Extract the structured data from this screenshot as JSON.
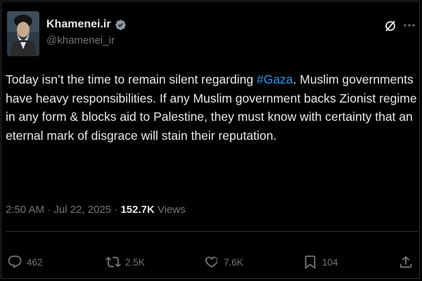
{
  "author": {
    "display_name": "Khamenei.ir",
    "handle": "@khamenei_ir",
    "verified_icon": "verified-badge-icon"
  },
  "tweet": {
    "text_before_hashtag": "Today isn’t the time to remain silent regarding ",
    "hashtag": "#Gaza",
    "text_after_hashtag": ". Muslim governments have heavy responsibilities. If any Muslim government backs Zionist regime in any form & blocks aid to Palestine, they must know with certainty that an eternal mark of disgrace will stain their reputation.",
    "timestamp": "2:50 AM · Jul 22, 2025 · ",
    "views_count": "152.7K",
    "views_label": " Views"
  },
  "actions": {
    "replies": "462",
    "reposts": "2.5K",
    "likes": "7.6K",
    "bookmarks": "104"
  },
  "colors": {
    "background": "#000000",
    "text": "#e7e9ea",
    "muted": "#71767b",
    "accent": "#1d9bf0"
  }
}
